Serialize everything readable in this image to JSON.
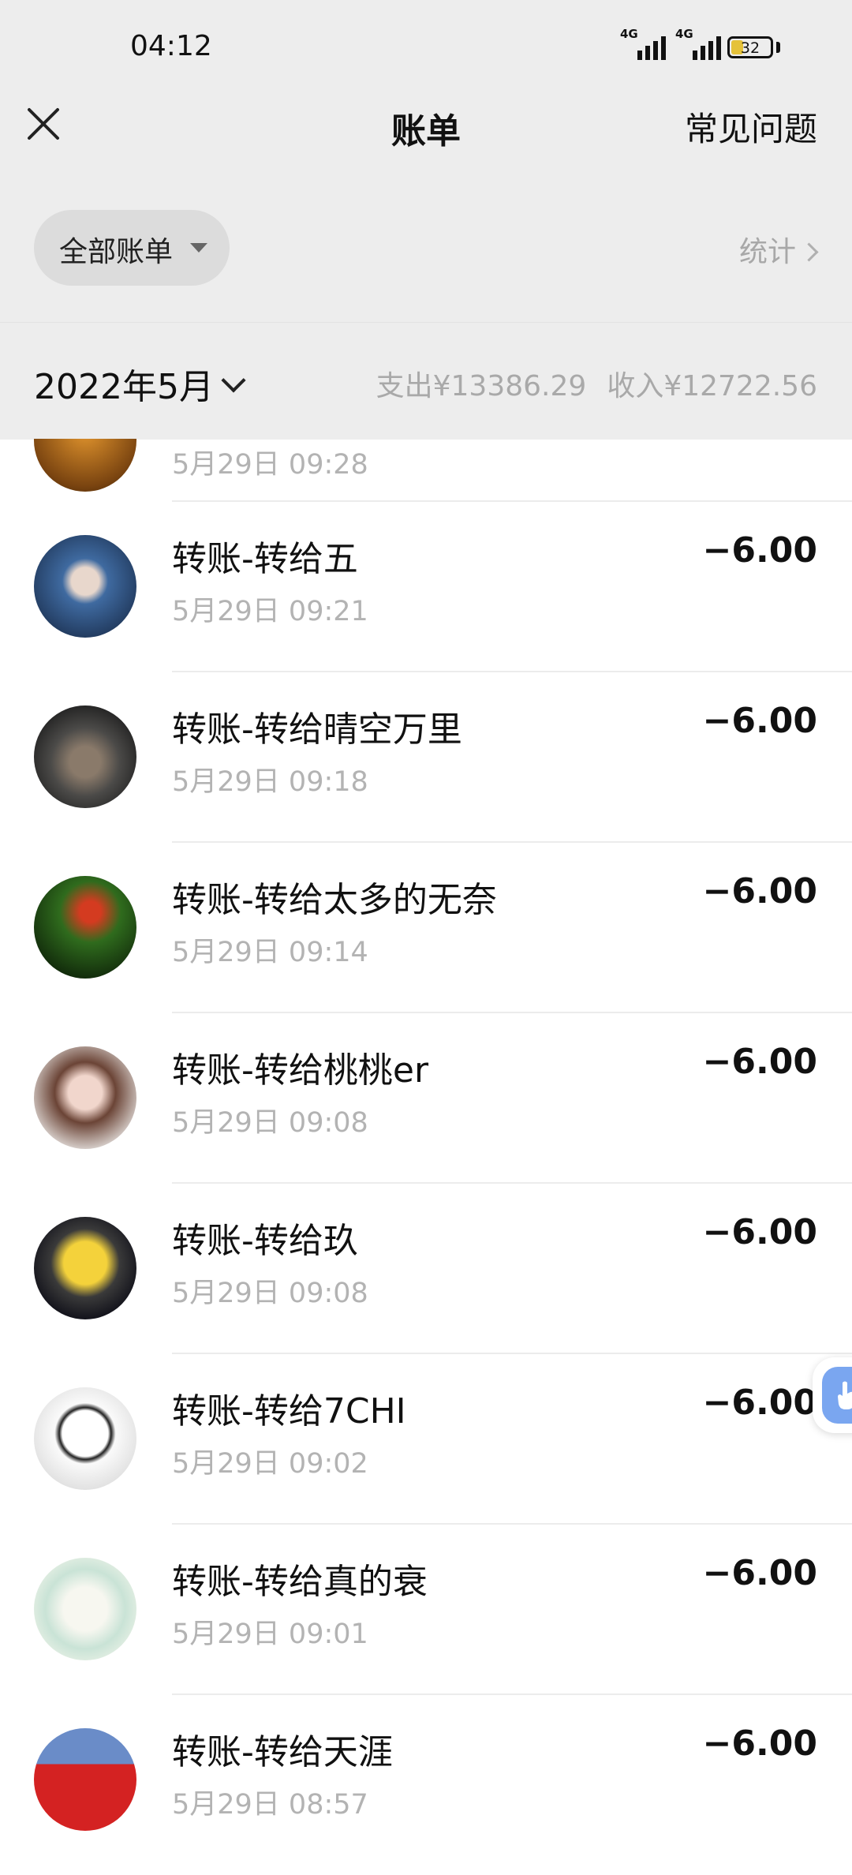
{
  "status_bar": {
    "time": "04:12",
    "network_1": "4G",
    "network_2": "4G",
    "battery_level": 32
  },
  "nav": {
    "title": "账单",
    "right_link": "常见问题",
    "close_icon": "close-icon"
  },
  "filter": {
    "dropdown_label": "全部账单",
    "stats_label": "统计"
  },
  "month": {
    "label": "2022年5月",
    "expense": "支出¥13386.29",
    "income": "收入¥12722.56"
  },
  "transactions": [
    {
      "title": "",
      "time": "5月29日 09:28",
      "amount": ""
    },
    {
      "title": "转账-转给五",
      "time": "5月29日 09:21",
      "amount": "−6.00"
    },
    {
      "title": "转账-转给晴空万里",
      "time": "5月29日 09:18",
      "amount": "−6.00"
    },
    {
      "title": "转账-转给太多的无奈",
      "time": "5月29日 09:14",
      "amount": "−6.00"
    },
    {
      "title": "转账-转给桃桃er",
      "time": "5月29日 09:08",
      "amount": "−6.00"
    },
    {
      "title": "转账-转给玖",
      "time": "5月29日 09:08",
      "amount": "−6.00"
    },
    {
      "title": "转账-转给7CHI",
      "time": "5月29日 09:02",
      "amount": "−6.00"
    },
    {
      "title": "转账-转给真的衰",
      "time": "5月29日 09:01",
      "amount": "−6.00"
    },
    {
      "title": "转账-转给天涯",
      "time": "5月29日 08:57",
      "amount": "−6.00"
    }
  ],
  "colors": {
    "header_bg": "#ededed",
    "muted_text": "#b3b3b3",
    "helper_blue": "#7aa6f0"
  }
}
